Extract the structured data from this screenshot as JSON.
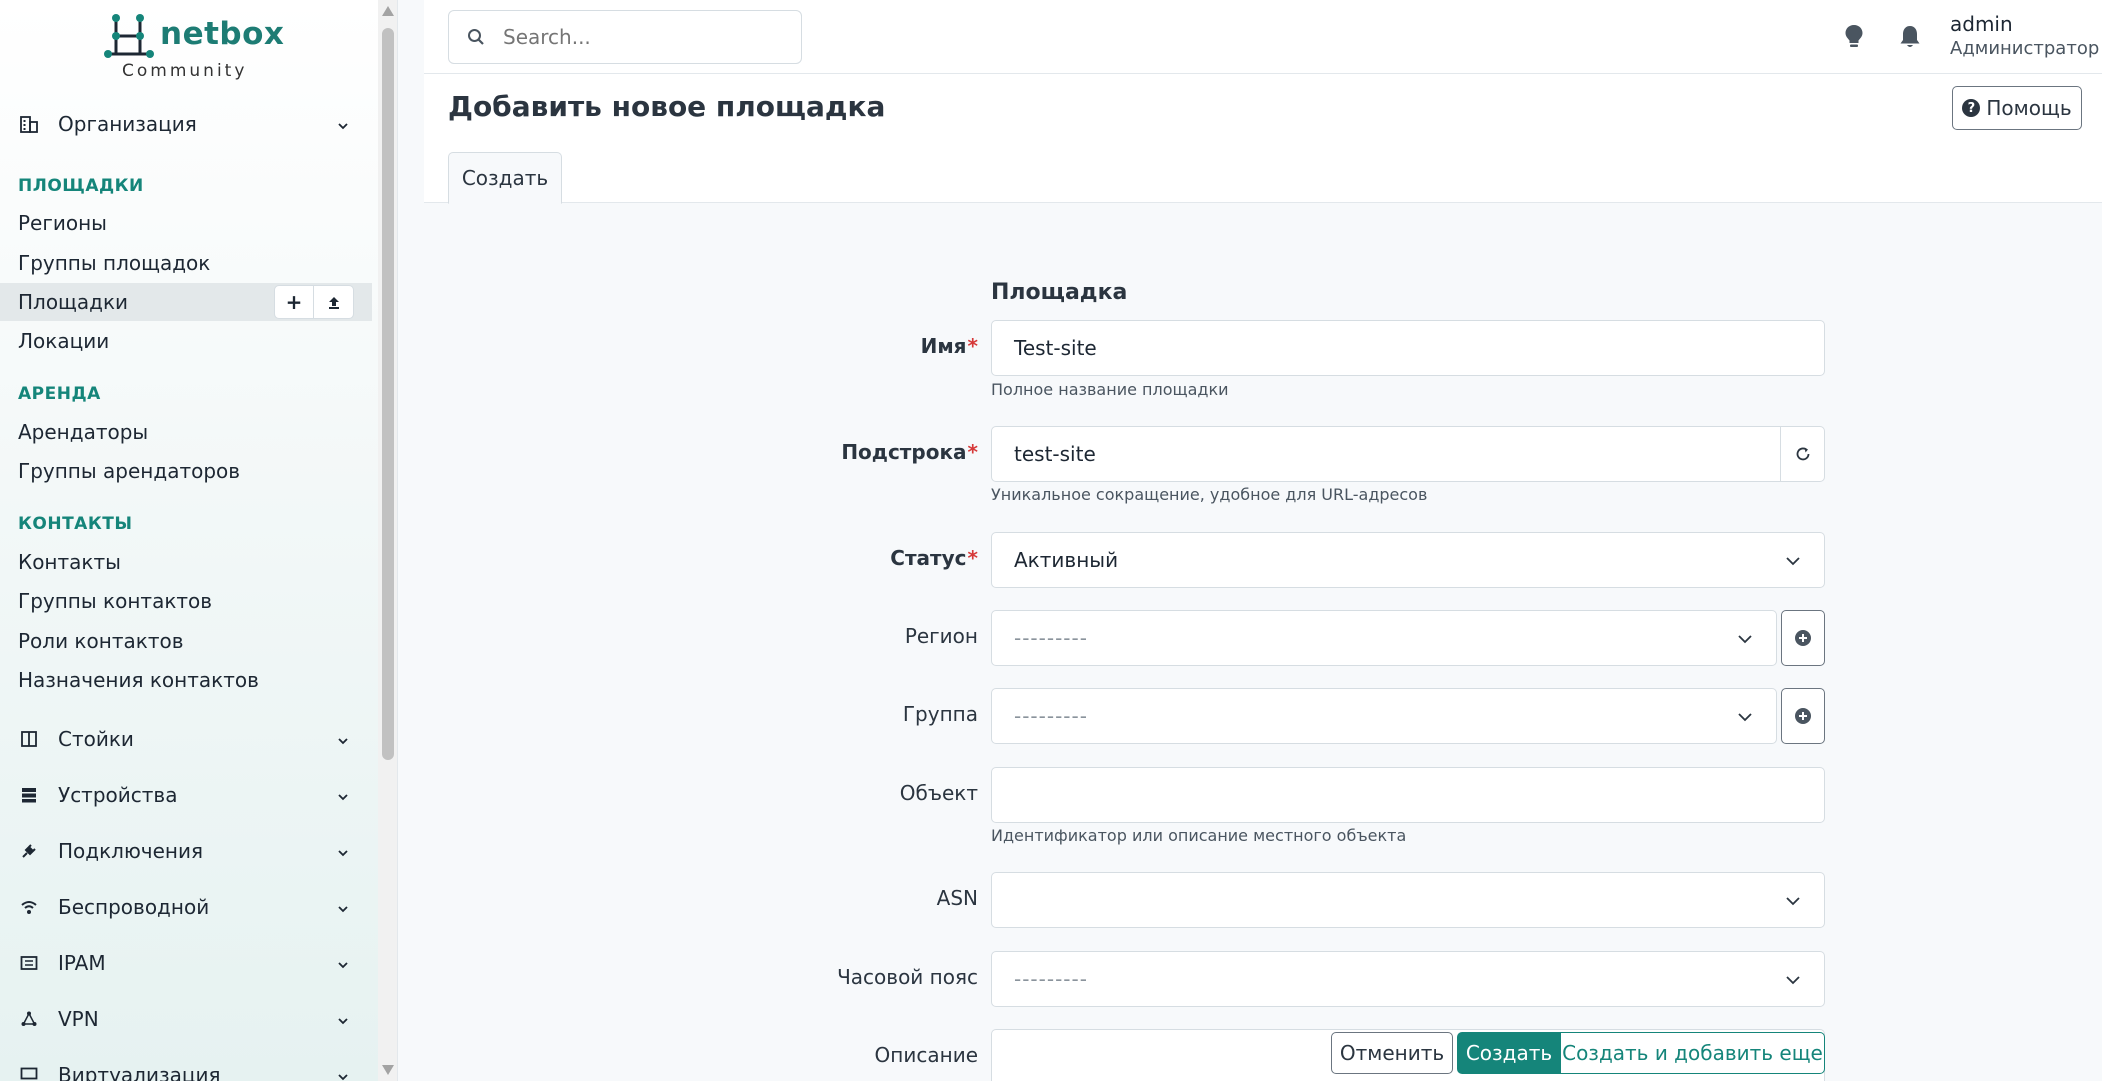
{
  "app": {
    "logo_word": "netbox",
    "logo_sub": "Community"
  },
  "search": {
    "placeholder": "Search..."
  },
  "user": {
    "name": "admin",
    "role": "Администратор"
  },
  "sidebar": {
    "top_groups": [
      {
        "label": "Организация",
        "icon": "building-icon"
      }
    ],
    "sections": {
      "sites": "ПЛОЩАДКИ",
      "tenancy": "АРЕНДА",
      "contacts": "КОНТАКТЫ"
    },
    "sites_items": [
      "Регионы",
      "Группы площадок",
      "Площадки",
      "Локации"
    ],
    "tenancy_items": [
      "Арендаторы",
      "Группы арендаторов"
    ],
    "contacts_items": [
      "Контакты",
      "Группы контактов",
      "Роли контактов",
      "Назначения контактов"
    ],
    "bottom_groups": [
      {
        "label": "Стойки",
        "icon": "rack-icon"
      },
      {
        "label": "Устройства",
        "icon": "server-icon"
      },
      {
        "label": "Подключения",
        "icon": "plug-icon"
      },
      {
        "label": "Беспроводной",
        "icon": "wifi-icon"
      },
      {
        "label": "IPAM",
        "icon": "ipam-icon"
      },
      {
        "label": "VPN",
        "icon": "vpn-icon"
      },
      {
        "label": "Виртуализация",
        "icon": "monitor-icon"
      }
    ],
    "active_item_buttons": {
      "add": "+",
      "import": "⤒"
    }
  },
  "page": {
    "title": "Добавить новое площадка",
    "help_label": "Помощь",
    "tab_label": "Создать"
  },
  "form": {
    "section_title": "Площадка",
    "name": {
      "label": "Имя",
      "value": "Test-site",
      "help": "Полное название площадки"
    },
    "slug": {
      "label": "Подстрока",
      "value": "test-site",
      "help": "Уникальное сокращение, удобное для URL-адресов"
    },
    "status": {
      "label": "Статус",
      "value": "Активный"
    },
    "region": {
      "label": "Регион",
      "value": "---------"
    },
    "group": {
      "label": "Группа",
      "value": "---------"
    },
    "facility": {
      "label": "Объект",
      "value": "",
      "help": "Идентификатор или описание местного объекта"
    },
    "asn": {
      "label": "ASN",
      "value": ""
    },
    "timezone": {
      "label": "Часовой пояс",
      "value": "---------"
    },
    "description": {
      "label": "Описание",
      "value": ""
    }
  },
  "actions": {
    "cancel": "Отменить",
    "create": "Создать",
    "create_add": "Создать и добавить еще"
  },
  "colors": {
    "accent": "#15857a",
    "required": "#d63939"
  }
}
